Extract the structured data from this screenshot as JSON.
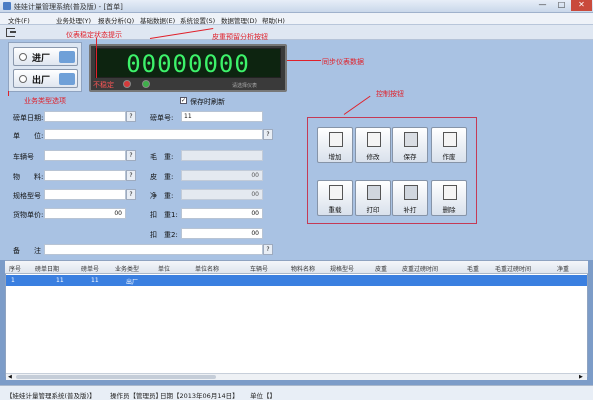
{
  "window": {
    "title": "娃娃计量管理系统(普及版) - [首单]",
    "min": "—",
    "max": "□",
    "close": "✕"
  },
  "menu": [
    "文件(F)",
    "业务处理(Y)",
    "报表分析(Q)",
    "基础数据(E)",
    "系统设置(S)",
    "数据管理(D)",
    "帮助(H)"
  ],
  "toolbar": {
    "icon": "exit-icon"
  },
  "inout": {
    "in_label": "进厂",
    "out_label": "出厂"
  },
  "meter": {
    "value": "00000000",
    "stable_label": "不稳定",
    "caption": "请选择仪表"
  },
  "annotations": {
    "status": "仪表稳定状态提示",
    "tare": "皮重预留分析按钮",
    "sync": "同步仪表数据",
    "biztype": "业务类型选项",
    "ctrl": "控制按钮"
  },
  "checkbox": {
    "label": "保存时刷新",
    "checked": true
  },
  "form": {
    "date_label": "磅单日期:",
    "date_value": "",
    "no_label": "磅单号:",
    "no_value": "11",
    "unit_label": "单　　位:",
    "plate_label": "车辆号",
    "goods_label": "物　　料:",
    "spec_label": "规格型号",
    "price_label": "货物单价:",
    "price_value": "00",
    "gross_label": "毛　重:",
    "tare_label": "皮　重:",
    "tare_value": "00",
    "net_label": "净　重:",
    "net_value": "00",
    "deduct1_label": "扣　重1:",
    "deduct1_value": "00",
    "deduct2_label": "扣　重2:",
    "deduct2_value": "00",
    "remark_label": "备　　注"
  },
  "controls": [
    {
      "label": "增加",
      "name": "add-button"
    },
    {
      "label": "修改",
      "name": "edit-button"
    },
    {
      "label": "保存",
      "name": "save-button"
    },
    {
      "label": "作废",
      "name": "void-button"
    },
    {
      "label": "重载",
      "name": "reload-button"
    },
    {
      "label": "打印",
      "name": "print-button"
    },
    {
      "label": "补打",
      "name": "reprint-button"
    },
    {
      "label": "删除",
      "name": "delete-button"
    }
  ],
  "table": {
    "columns": [
      "序号",
      "磅单日期",
      "磅单号",
      "业务类型",
      "单位",
      "单位名称",
      "车辆号",
      "物料名称",
      "规格型号",
      "皮重",
      "皮重过磅时间",
      "毛重",
      "毛重过磅时间",
      "净重"
    ],
    "rows": [
      [
        "1",
        "11",
        "11",
        "出厂",
        "",
        "",
        "",
        "",
        "",
        "",
        "",
        "",
        "",
        ""
      ]
    ]
  },
  "status": {
    "company": "【娃娃计量管理系统(普及版)】",
    "operator": "操作员【管理员】",
    "date": "日期【2013年06月14日】",
    "unit": "单位【】"
  },
  "colors": {
    "digits": "#3df26a",
    "annotation": "#e0202a",
    "selection": "#3a7fe0"
  }
}
